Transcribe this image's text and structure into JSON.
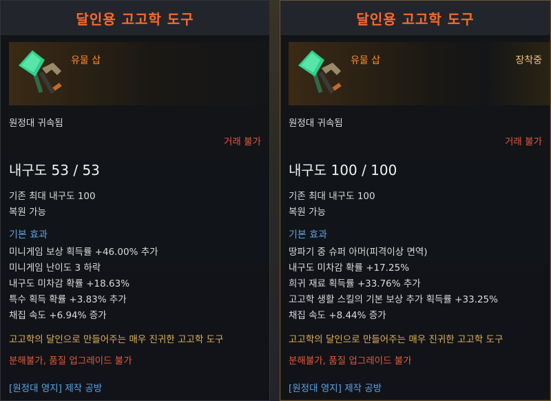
{
  "panels": [
    {
      "title": "달인용 고고학 도구",
      "grade": "유물 삽",
      "equipped": "",
      "bound": "원정대 귀속됨",
      "trade": "거래 불가",
      "durability": "내구도 53 / 53",
      "max_durability": "기존 최대 내구도 100",
      "repairable": "복원 가능",
      "basic_effect_label": "기본 효과",
      "effects": [
        "미니게임 보상 획득률 +46.00% 추가",
        "미니게임 난이도 3 하락",
        "내구도 미차감 확률 +18.63%",
        "특수 획득 확률 +3.83% 추가",
        "채집 속도 +6.94% 증가"
      ],
      "description": "고고학의 달인으로 만들어주는 매우 진귀한 고고학 도구",
      "restriction": "분해불가, 품질 업그레이드 불가",
      "crafting": "[원정대 영지] 제작 공방"
    },
    {
      "title": "달인용 고고학 도구",
      "grade": "유물 삽",
      "equipped": "장착중",
      "bound": "원정대 귀속됨",
      "trade": "거래 불가",
      "durability": "내구도 100 / 100",
      "max_durability": "기존 최대 내구도 100",
      "repairable": "복원 가능",
      "basic_effect_label": "기본 효과",
      "effects": [
        "땅파기 중 슈퍼 아머(피격이상 면역)",
        "내구도 미차감 확률 +17.25%",
        "희귀 재료 획득률 +33.76% 추가",
        "고고학 생활 스킬의 기본 보상 추가 획득률 +33.25%",
        "채집 속도 +8.44% 증가"
      ],
      "description": "고고학의 달인으로 만들어주는 매우 진귀한 고고학 도구",
      "restriction": "분해불가, 품질 업그레이드 불가",
      "crafting": "[원정대 영지] 제작 공방"
    }
  ],
  "colors": {
    "title": "#ff6a2a",
    "grade": "#ff8a2a",
    "warning": "#e25a3a",
    "basic_effect": "#5aa6e6",
    "description": "#e0b056",
    "equipped": "#f0c676"
  },
  "icon": "shovel-pickaxe-icon"
}
